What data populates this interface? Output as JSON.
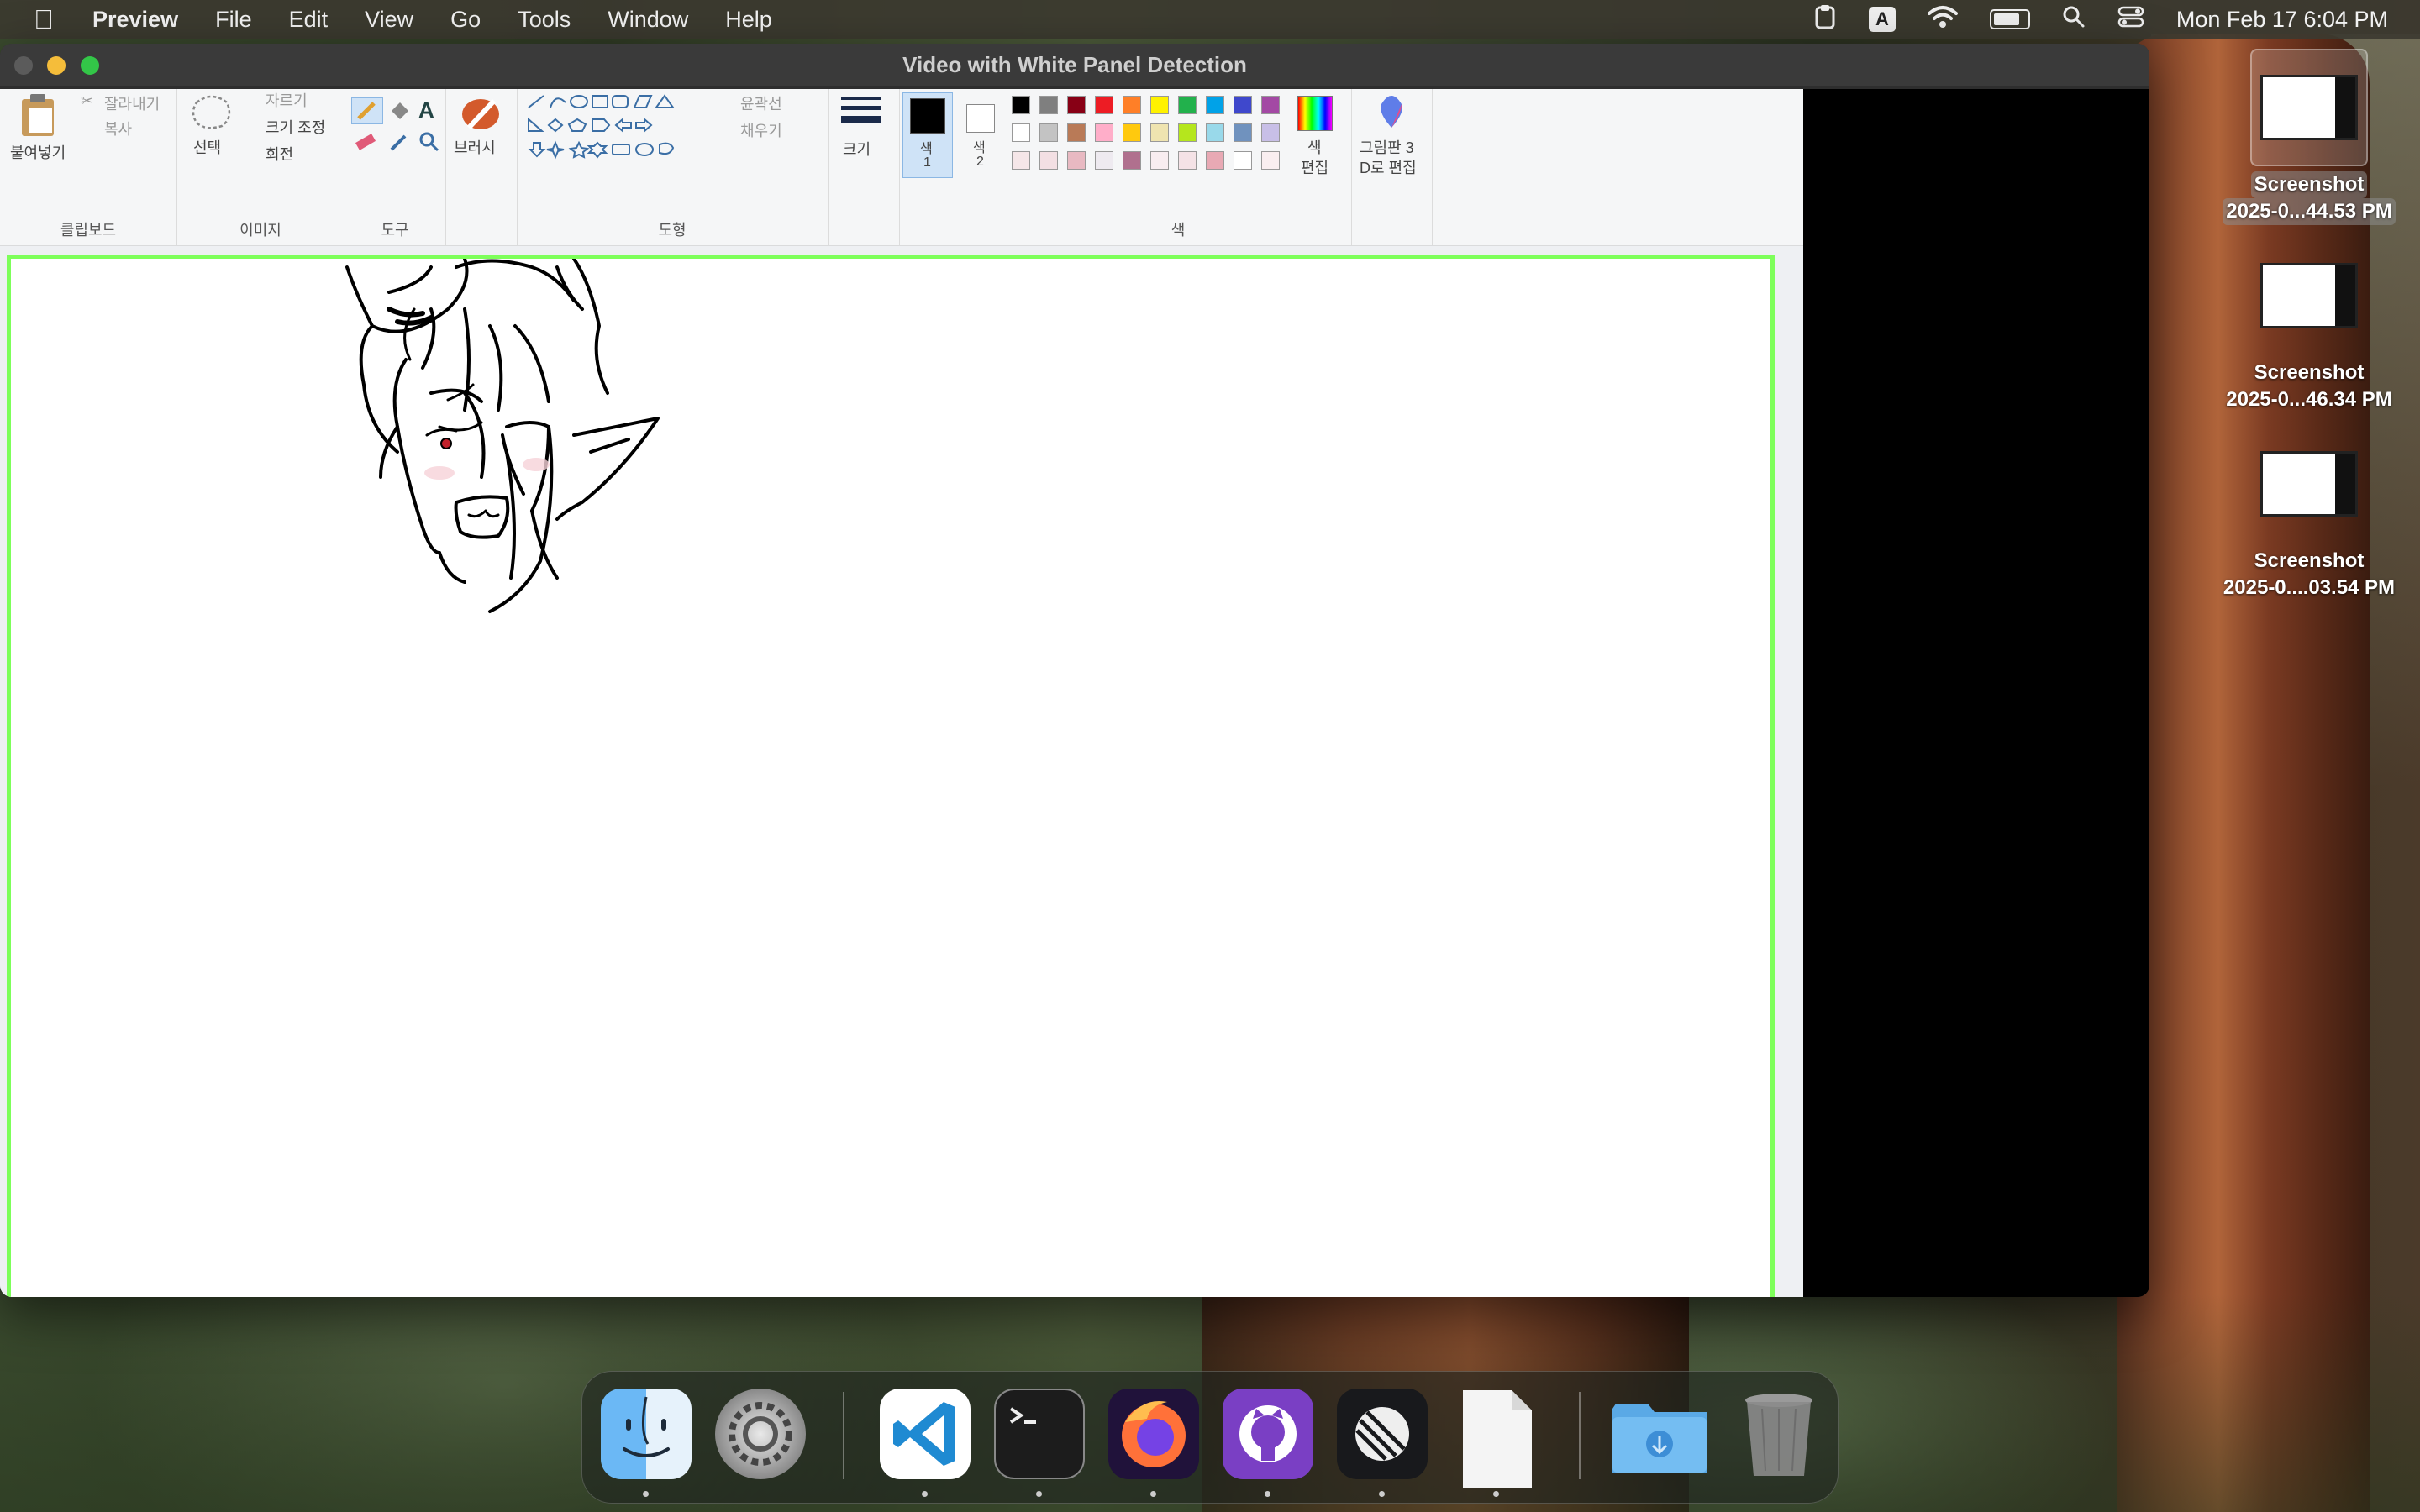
{
  "menubar": {
    "app_name": "Preview",
    "items": [
      "File",
      "Edit",
      "View",
      "Go",
      "Tools",
      "Window",
      "Help"
    ],
    "input_source": "A",
    "clock": "Mon Feb 17  6:04 PM"
  },
  "window": {
    "title": "Video with White Panel Detection"
  },
  "paint": {
    "clipboard": {
      "paste": "붙여넣기",
      "cut": "잘라내기",
      "copy": "복사",
      "label": "클립보드"
    },
    "image": {
      "select": "선택",
      "crop": "자르기",
      "resize": "크기 조정",
      "rotate": "회전",
      "label": "이미지"
    },
    "tools": {
      "label": "도구"
    },
    "brush": {
      "label": "브러시"
    },
    "shapes": {
      "outline": "윤곽선",
      "fill": "채우기",
      "label": "도형"
    },
    "size": {
      "label": "크기"
    },
    "color1": {
      "label1": "색",
      "label2": "1"
    },
    "color2": {
      "label1": "색",
      "label2": "2"
    },
    "colors": {
      "label": "색"
    },
    "edit_colors": {
      "label1": "색",
      "label2": "편집"
    },
    "paint3d": {
      "label1": "그림판 3",
      "label2": "D로 편집"
    },
    "palette_row1": [
      "#000000",
      "#7f7f7f",
      "#880015",
      "#ed1c24",
      "#ff7f27",
      "#fff200",
      "#22b14c",
      "#00a2e8",
      "#3f48cc",
      "#a349a4"
    ],
    "palette_row2": [
      "#ffffff",
      "#c3c3c3",
      "#b97a57",
      "#ffaec9",
      "#ffc90e",
      "#efe4b0",
      "#b5e61d",
      "#99d9ea",
      "#7092be",
      "#c8bfe7"
    ],
    "palette_row3": [
      "#f5e6e8",
      "#f3dfe3",
      "#e8b9c2",
      "#eeeaf0",
      "#b0708e",
      "#f8edf0",
      "#f4e2e6",
      "#e8a9b4",
      "#ffffff",
      "#f9eef0"
    ]
  },
  "desktop_icons": [
    {
      "line1": "Screenshot",
      "line2": "2025-0...44.53 PM",
      "selected": true
    },
    {
      "line1": "Screenshot",
      "line2": "2025-0...46.34 PM",
      "selected": false
    },
    {
      "line1": "Screenshot",
      "line2": "2025-0....03.54 PM",
      "selected": false
    }
  ],
  "dock": {
    "apps": [
      "Finder",
      "System Settings",
      "Visual Studio Code",
      "Terminal",
      "Firefox",
      "GitHub Desktop",
      "Linear",
      "Document",
      "Downloads",
      "Trash"
    ]
  },
  "colors": {
    "panel_border": "#7dff5a",
    "traffic_min": "#f5bd3a",
    "traffic_max": "#33c648"
  }
}
